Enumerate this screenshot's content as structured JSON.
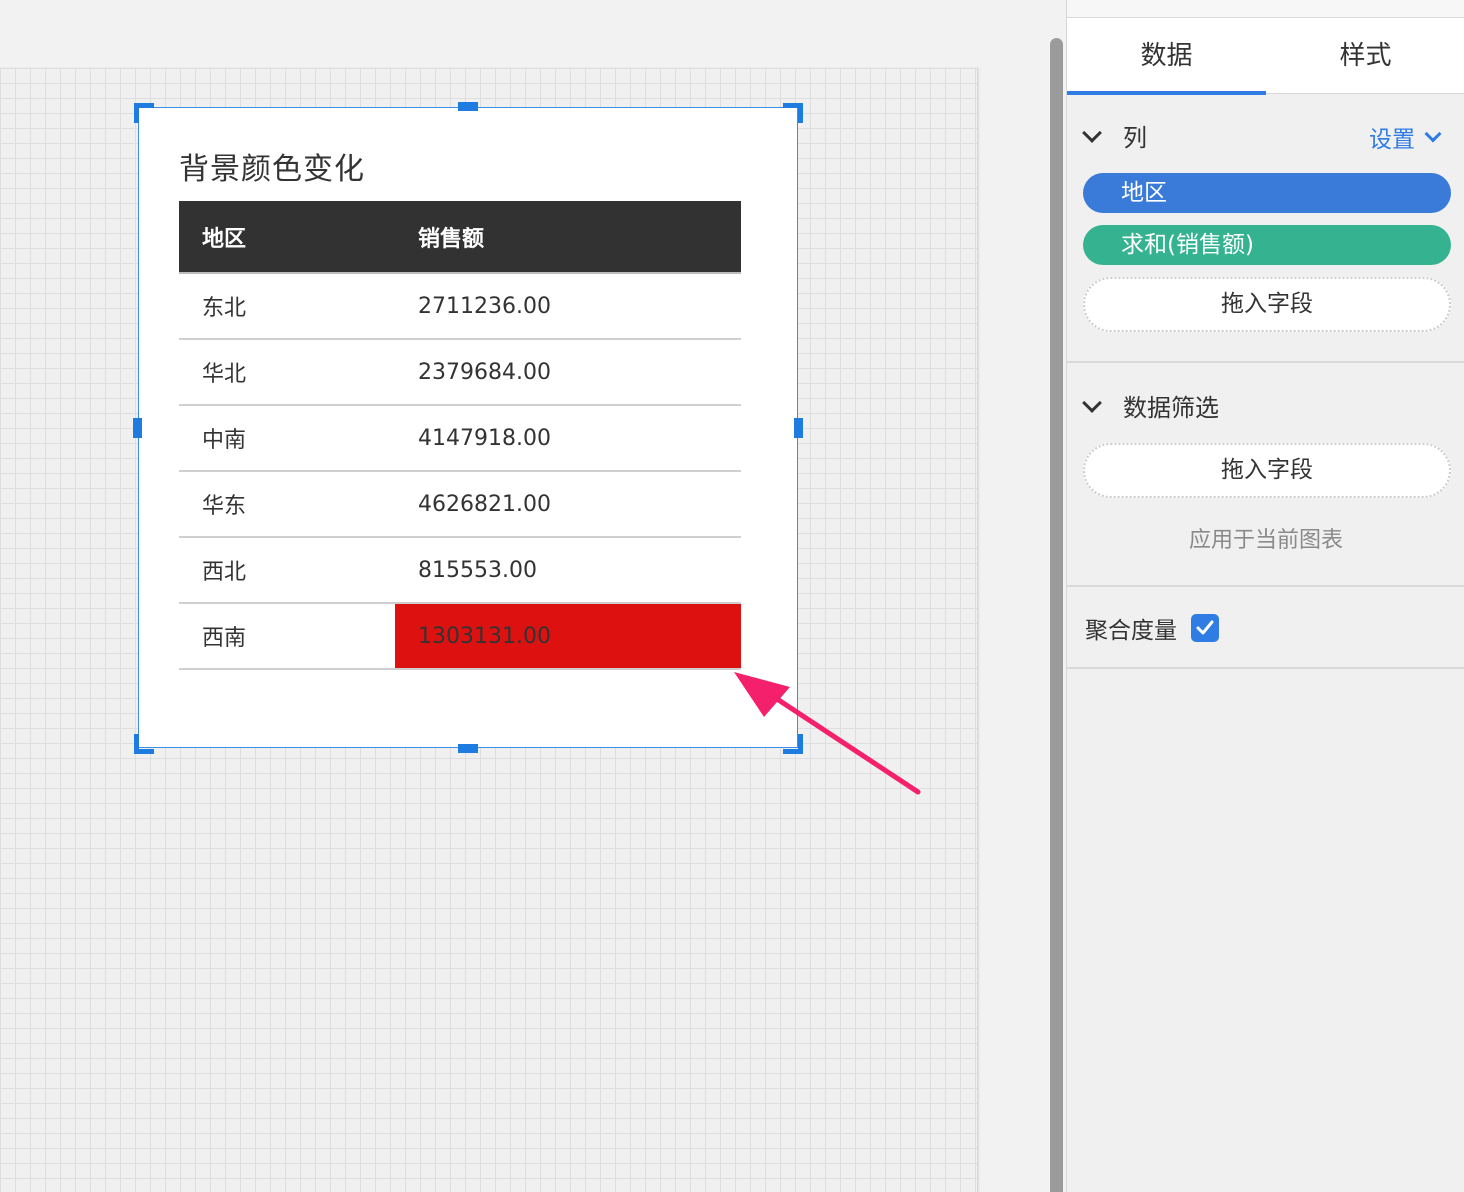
{
  "widget": {
    "title": "背景颜色变化",
    "table": {
      "columns": [
        "地区",
        "销售额"
      ],
      "rows": [
        {
          "region": "东北",
          "sales": "2711236.00",
          "highlight": false
        },
        {
          "region": "华北",
          "sales": "2379684.00",
          "highlight": false
        },
        {
          "region": "中南",
          "sales": "4147918.00",
          "highlight": false
        },
        {
          "region": "华东",
          "sales": "4626821.00",
          "highlight": false
        },
        {
          "region": "西北",
          "sales": "815553.00",
          "highlight": false
        },
        {
          "region": "西南",
          "sales": "1303131.00",
          "highlight": true
        }
      ]
    },
    "highlight_color": "#de1111"
  },
  "annotation": {
    "arrow_color": "#f5206b"
  },
  "panel": {
    "tabs": [
      {
        "label": "数据",
        "active": true
      },
      {
        "label": "样式",
        "active": false
      }
    ],
    "columns_section": {
      "title": "列",
      "settings_label": "设置",
      "fields": [
        {
          "label": "地区",
          "color": "#3a7ad8"
        },
        {
          "label": "求和(销售额)",
          "color": "#35b390"
        }
      ],
      "drop_label": "拖入字段"
    },
    "filter_section": {
      "title": "数据筛选",
      "drop_label": "拖入字段",
      "apply_hint": "应用于当前图表"
    },
    "aggregate": {
      "label": "聚合度量",
      "checked": true
    }
  },
  "colors": {
    "accent": "#2e7ce4",
    "selection": "#1e7be0"
  }
}
